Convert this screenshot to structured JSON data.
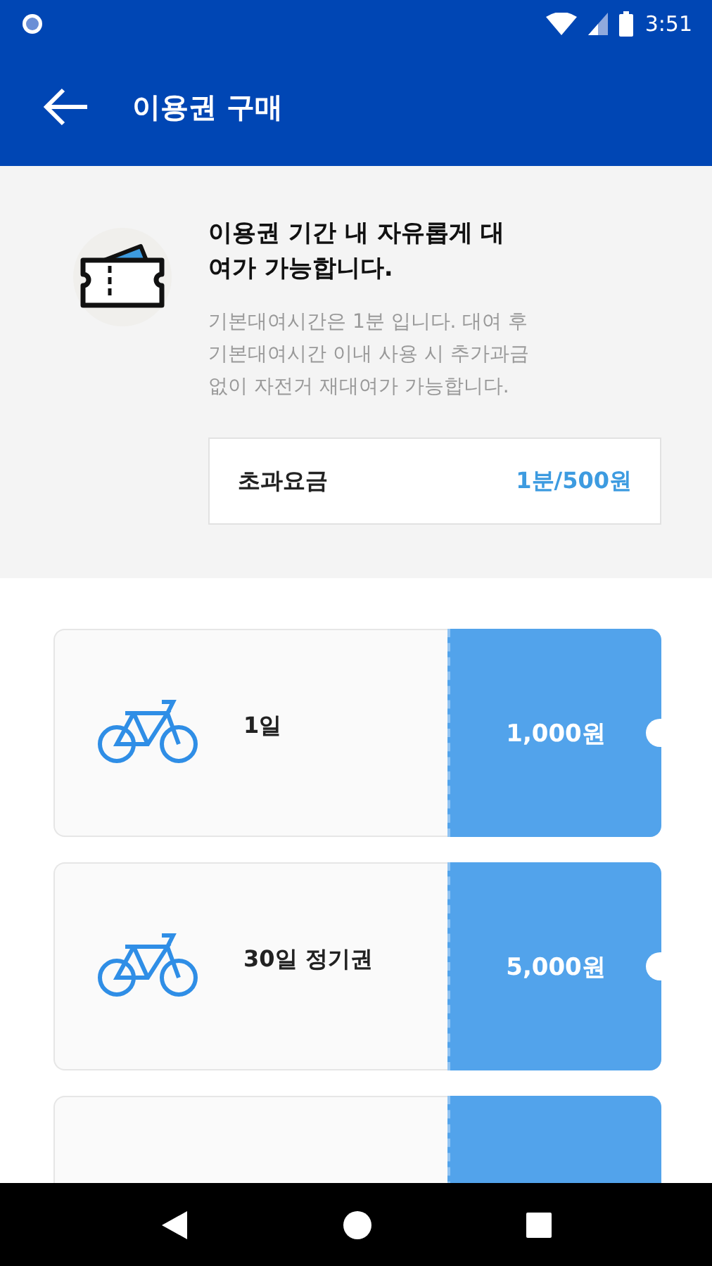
{
  "status_bar": {
    "time": "3:51"
  },
  "app_bar": {
    "title": "이용권 구매"
  },
  "info": {
    "heading": "이용권 기간 내 자유롭게 대여가 가능합니다.",
    "description": "기본대여시간은 1분 입니다. 대여 후 기본대여시간 이내 사용 시 추가과금 없이 자전거 재대여가 가능합니다.",
    "fee_label": "초과요금",
    "fee_value": "1분/500원"
  },
  "passes": [
    {
      "kind": "pass",
      "label": "1일",
      "price": "1,000원"
    },
    {
      "kind": "pass",
      "label": "30일 정기권",
      "price": "5,000원"
    },
    {
      "kind": "cut"
    }
  ]
}
